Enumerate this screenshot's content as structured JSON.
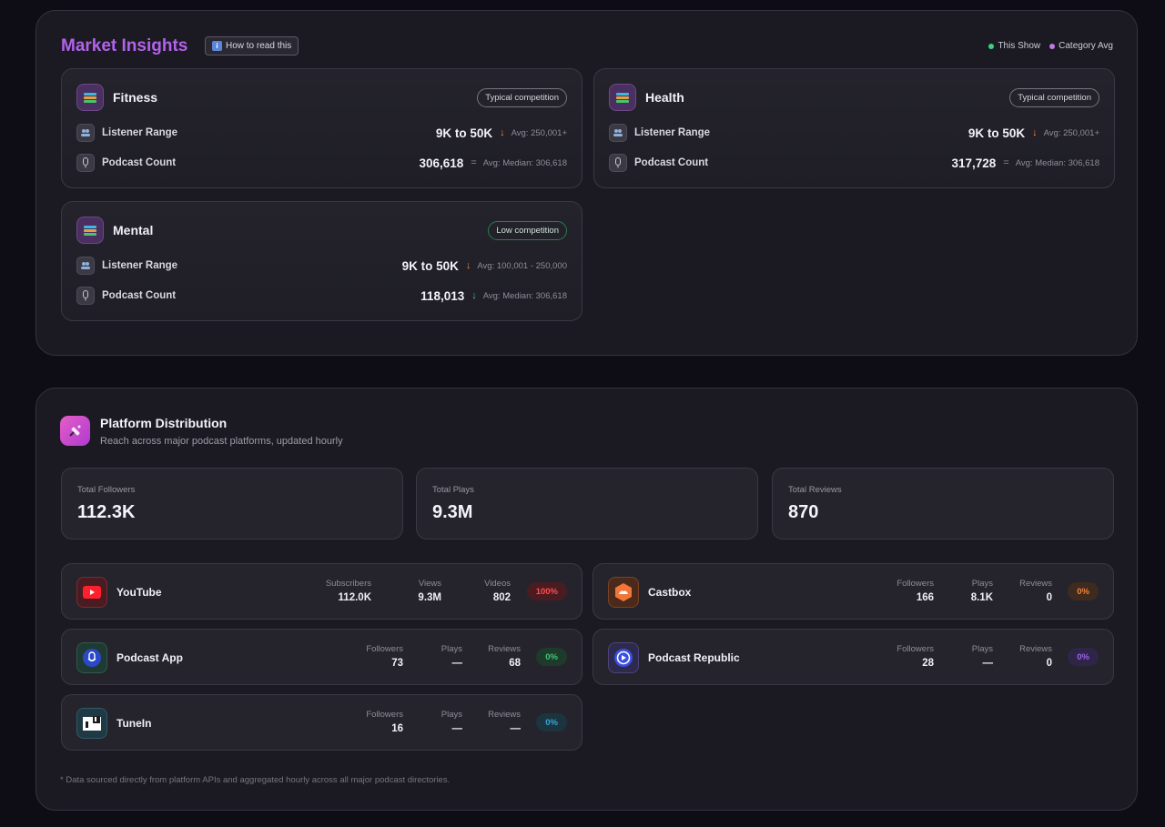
{
  "market": {
    "title": "Market Insights",
    "help_label": "How to read this",
    "legend": [
      {
        "label": "This Show",
        "color": "#3fd07f"
      },
      {
        "label": "Category Avg",
        "color": "#c07ae8"
      }
    ],
    "categories": [
      {
        "name": "Fitness",
        "competition": "Typical competition",
        "listener_label": "Listener Range",
        "listener_value": "9K to 50K",
        "listener_trend": "↓",
        "listener_avg": "Avg: 250,001+",
        "podcast_label": "Podcast Count",
        "podcast_value": "306,618",
        "podcast_trend": "=",
        "podcast_avg": "Avg: Median: 306,618"
      },
      {
        "name": "Health",
        "competition": "Typical competition",
        "listener_label": "Listener Range",
        "listener_value": "9K to 50K",
        "listener_trend": "↓",
        "listener_avg": "Avg: 250,001+",
        "podcast_label": "Podcast Count",
        "podcast_value": "317,728",
        "podcast_trend": "=",
        "podcast_avg": "Avg: Median: 306,618"
      },
      {
        "name": "Mental",
        "competition": "Low competition",
        "listener_label": "Listener Range",
        "listener_value": "9K to 50K",
        "listener_trend": "↓",
        "listener_avg": "Avg: 100,001 - 250,000",
        "podcast_label": "Podcast Count",
        "podcast_value": "118,013",
        "podcast_trend": "↓",
        "podcast_avg": "Avg: Median: 306,618"
      }
    ]
  },
  "platform": {
    "title": "Platform Distribution",
    "subtitle": "Reach across major podcast platforms, updated hourly",
    "totals": [
      {
        "label": "Total Followers",
        "value": "112.3K"
      },
      {
        "label": "Total Plays",
        "value": "9.3M"
      },
      {
        "label": "Total Reviews",
        "value": "870"
      }
    ],
    "platforms": [
      {
        "name": "YouTube",
        "s1_label": "Subscribers",
        "s1_value": "112.0K",
        "s2_label": "Views",
        "s2_value": "9.3M",
        "s3_label": "Videos",
        "s3_value": "802",
        "pct": "100%",
        "pct_color": "#ff4d4d",
        "logo": "youtube-logo"
      },
      {
        "name": "Castbox",
        "s1_label": "Followers",
        "s1_value": "166",
        "s2_label": "Plays",
        "s2_value": "8.1K",
        "s3_label": "Reviews",
        "s3_value": "0",
        "pct": "0%",
        "pct_color": "#f2843a",
        "logo": "castbox-logo"
      },
      {
        "name": "Podcast App",
        "s1_label": "Followers",
        "s1_value": "73",
        "s2_label": "Plays",
        "s2_value": "—",
        "s3_label": "Reviews",
        "s3_value": "68",
        "pct": "0%",
        "pct_color": "#3ec97a",
        "logo": "podcast-app-logo"
      },
      {
        "name": "Podcast Republic",
        "s1_label": "Followers",
        "s1_value": "28",
        "s2_label": "Plays",
        "s2_value": "—",
        "s3_label": "Reviews",
        "s3_value": "0",
        "pct": "0%",
        "pct_color": "#9b63e6",
        "logo": "podcast-republic-logo"
      },
      {
        "name": "TuneIn",
        "s1_label": "Followers",
        "s1_value": "16",
        "s2_label": "Plays",
        "s2_value": "—",
        "s3_label": "Reviews",
        "s3_value": "—",
        "pct": "0%",
        "pct_color": "#3aa6d6",
        "logo": "tunein-logo"
      }
    ],
    "footnote": "* Data sourced directly from platform APIs and aggregated hourly across all major podcast directories."
  }
}
